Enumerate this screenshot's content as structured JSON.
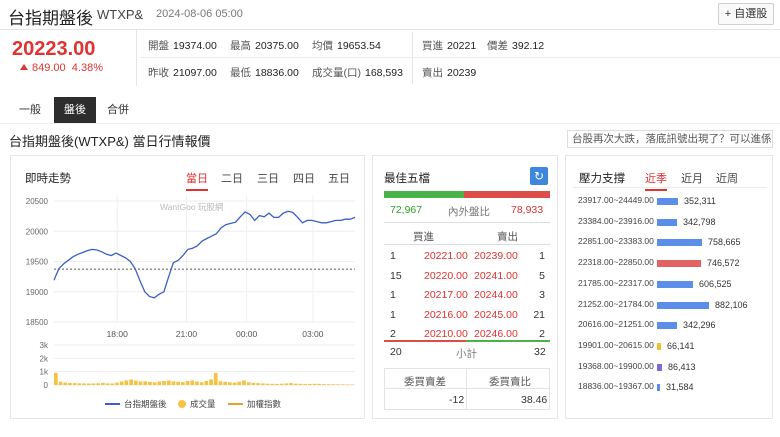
{
  "header": {
    "title": "台指期盤後",
    "code": "WTXP&",
    "timestamp": "2024-08-06 05:00",
    "add_watchlist": "+ 自選股"
  },
  "quote": {
    "price": "20223.00",
    "change": "849.00",
    "change_pct": "4.38%",
    "open_label": "開盤",
    "open": "19374.00",
    "high_label": "最高",
    "high": "20375.00",
    "avg_label": "均價",
    "avg": "19653.54",
    "prev_label": "昨收",
    "prev": "21097.00",
    "low_label": "最低",
    "low": "18836.00",
    "vol_label": "成交量(口)",
    "vol": "168,593",
    "bid_label": "買進",
    "bid": "20221",
    "spread_label": "價差",
    "spread": "392.12",
    "ask_label": "賣出",
    "ask": "20239"
  },
  "tabs": [
    {
      "label": "一般"
    },
    {
      "label": "盤後",
      "active": true
    },
    {
      "label": "合併"
    }
  ],
  "section_title": "台指期盤後(WTXP&) 當日行情報價",
  "news_link": "台股再次大跌，落底訊號出現了？可以進係...",
  "intraday": {
    "title": "即時走勢",
    "ranges": [
      "當日",
      "二日",
      "三日",
      "四日",
      "五日"
    ],
    "active_range": "當日",
    "watermark": "WantGoo 玩股網",
    "legend": [
      "台指期盤後",
      "成交量",
      "加權指數"
    ]
  },
  "chart_data": [
    {
      "type": "line",
      "title": "即時走勢",
      "x_ticks": [
        "18:00",
        "21:00",
        "00:00",
        "03:00"
      ],
      "y_ticks": [
        "20500",
        "20000",
        "19500",
        "19000",
        "18500"
      ],
      "ylim": [
        18500,
        20600
      ],
      "reference_line": 19374,
      "series": [
        {
          "name": "台指期盤後",
          "values": [
            19190,
            19380,
            19460,
            19520,
            19580,
            19620,
            19650,
            19680,
            19700,
            19690,
            19660,
            19620,
            19600,
            19640,
            19600,
            19560,
            19500,
            19380,
            19180,
            19000,
            18920,
            18900,
            18960,
            19000,
            19250,
            19480,
            19520,
            19600,
            19700,
            19720,
            19760,
            19840,
            19880,
            19920,
            19960,
            20060,
            20110,
            20130,
            20150,
            20240,
            20320,
            20280,
            20180,
            20260,
            20240,
            20300,
            20230,
            20230,
            20300,
            20330,
            20310,
            20230,
            20140,
            20180,
            20180,
            20160,
            20140,
            20140,
            20160,
            20180,
            20180,
            20200,
            20200,
            20230
          ]
        }
      ]
    },
    {
      "type": "bar",
      "title": "成交量",
      "y_ticks": [
        "3k",
        "2k",
        "1k",
        "0"
      ],
      "ylim": [
        0,
        3000
      ],
      "series": [
        {
          "name": "成交量",
          "values": [
            900,
            250,
            180,
            160,
            140,
            130,
            120,
            110,
            120,
            130,
            150,
            120,
            110,
            180,
            260,
            340,
            420,
            320,
            260,
            280,
            240,
            200,
            260,
            300,
            340,
            280,
            240,
            220,
            300,
            340,
            260,
            200,
            300,
            420,
            900,
            280,
            240,
            200,
            180,
            240,
            340,
            200,
            160,
            140,
            120,
            100,
            90,
            80,
            100,
            120,
            140,
            100,
            90,
            80,
            80,
            90,
            80,
            70,
            60,
            60,
            50,
            50,
            45,
            40
          ]
        }
      ]
    },
    {
      "type": "bar",
      "title": "壓力支撐",
      "categories": [
        "23917.00~24449.00",
        "23384.00~23916.00",
        "22851.00~23383.00",
        "22318.00~22850.00",
        "21785.00~22317.00",
        "21252.00~21784.00",
        "20616.00~21251.00",
        "19901.00~20615.00",
        "19368.00~19900.00",
        "18836.00~19367.00"
      ],
      "values": [
        352311,
        342798,
        758665,
        746572,
        606525,
        882106,
        342296,
        66141,
        86413,
        31584
      ]
    }
  ],
  "best_five": {
    "title": "最佳五檔",
    "refresh_icon": "refresh-icon",
    "inner_volume": "72,967",
    "ratio_label": "內外盤比",
    "outer_volume": "78,933",
    "bid_header": "買進",
    "ask_header": "賣出",
    "rows": [
      {
        "bid_qty": "1",
        "bid": "20221.00",
        "ask": "20239.00",
        "ask_qty": "1"
      },
      {
        "bid_qty": "15",
        "bid": "20220.00",
        "ask": "20241.00",
        "ask_qty": "5"
      },
      {
        "bid_qty": "1",
        "bid": "20217.00",
        "ask": "20244.00",
        "ask_qty": "3"
      },
      {
        "bid_qty": "1",
        "bid": "20216.00",
        "ask": "20245.00",
        "ask_qty": "21"
      },
      {
        "bid_qty": "2",
        "bid": "20210.00",
        "ask": "20246.00",
        "ask_qty": "2"
      }
    ],
    "total_bid": "20",
    "subtotal_label": "小計",
    "total_ask": "32",
    "diff_label": "委買賣差",
    "ratio2_label": "委買賣比",
    "diff": "-12",
    "ratio": "38.46"
  },
  "pressure": {
    "title": "壓力支撐",
    "tabs": [
      "近季",
      "近月",
      "近周"
    ],
    "active_tab": "近季",
    "items": [
      {
        "range": "23917.00~24449.00",
        "value": "352,311",
        "color": "#5b8ee8"
      },
      {
        "range": "23384.00~23916.00",
        "value": "342,798",
        "color": "#5b8ee8"
      },
      {
        "range": "22851.00~23383.00",
        "value": "758,665",
        "color": "#5b8ee8"
      },
      {
        "range": "22318.00~22850.00",
        "value": "746,572",
        "color": "#e06262"
      },
      {
        "range": "21785.00~22317.00",
        "value": "606,525",
        "color": "#5b8ee8"
      },
      {
        "range": "21252.00~21784.00",
        "value": "882,106",
        "color": "#5b8ee8"
      },
      {
        "range": "20616.00~21251.00",
        "value": "342,296",
        "color": "#5b8ee8"
      },
      {
        "range": "19901.00~20615.00",
        "value": "66,141",
        "color": "#f0c030"
      },
      {
        "range": "19368.00~19900.00",
        "value": "86,413",
        "color": "#7a6bd8"
      },
      {
        "range": "18836.00~19367.00",
        "value": "31,584",
        "color": "#5b8ee8"
      }
    ]
  },
  "colors": {
    "up": "#e0322f",
    "down": "#2aa52a",
    "line": "#3b5fc7",
    "volume": "#f5c242",
    "index": "#e7a02a"
  }
}
